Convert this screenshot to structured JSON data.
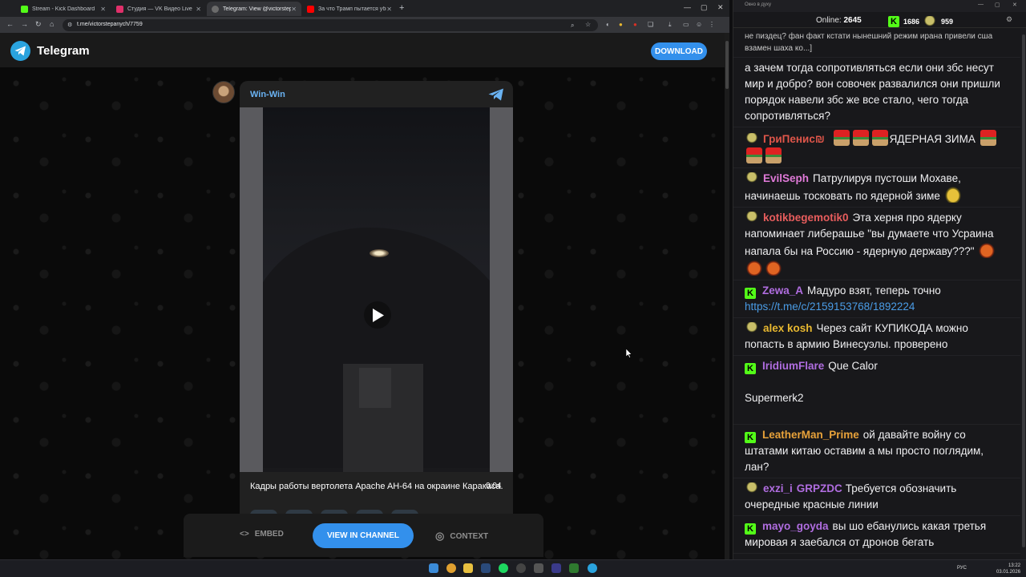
{
  "browser": {
    "tabs": [
      {
        "label": "Stream - Kick Dashboard",
        "active": false,
        "favicon_color": "#53fc18"
      },
      {
        "label": "Студия — VK Видео Live",
        "active": false,
        "favicon_color": "#e0306a"
      },
      {
        "label": "Telegram: View @victorstepanych",
        "active": true,
        "favicon_color": "#6b6b6b"
      },
      {
        "label": "За что Трамп пытается убить Мадуро",
        "active": false,
        "favicon_color": "#ff0000"
      }
    ],
    "new_tab": "+",
    "url": "t.me/victorstepanych/7759"
  },
  "telegram": {
    "brand": "Telegram",
    "download_label": "DOWNLOAD",
    "post": {
      "channel": "Win-Win",
      "duration": "0:04",
      "caption": "Кадры работы вертолета Apache AH-64 на окраине Каракаса."
    },
    "actions": {
      "embed": "EMBED",
      "view_in_channel": "VIEW IN CHANNEL",
      "context": "CONTEXT"
    }
  },
  "chat": {
    "window_title": "Окно в духу",
    "online_label": "Online:",
    "online_count": "2645",
    "kick_count": "1686",
    "other_count": "959",
    "messages": [
      {
        "partial": true,
        "text": "не пиздец? фан факт кстати нынешний режим ирана привели сша взамен шаха ко...]"
      },
      {
        "partial": false,
        "text": "а зачем тогда сопротивляться если они збс несут мир и добро? вон совочек развалился они пришли порядок навели збс же все стало, чего тогда сопротивляться?"
      },
      {
        "badge": "y",
        "user": "ГриПенис₪",
        "user_color": "#e0564a",
        "text": "ЯДЕРНАЯ ЗИМА",
        "emotes_before": 3,
        "emotes_after": 2,
        "emote": "gnome"
      },
      {
        "badge": "y",
        "user": "EvilSeph",
        "user_color": "#e07ad8",
        "text": "Патрулируя пустоши Мохаве, начинаешь тосковать по ядерной зиме",
        "emotes_after": 1,
        "emote": "fish"
      },
      {
        "badge": "y",
        "user": "kotikbegemotik0",
        "user_color": "#e85d5d",
        "text": "Эта херня про ядерку напоминает либерашье \"вы думаете что Усраина напала бы на Россию - ядерную державу???\"",
        "emotes_after": 3,
        "emote": "fox"
      },
      {
        "badge": "k",
        "user": "Zewa_A",
        "user_color": "#b06de0",
        "text": "Мадуро взят, теперь точно",
        "link": "https://t.me/c/2159153768/1892224"
      },
      {
        "badge": "y",
        "user": "alex kosh",
        "user_color": "#e8b830",
        "text": "Через сайт КУПИКОДА можно попасть в армию Винесуэлы. проверено"
      },
      {
        "badge": "k",
        "user": "IridiumFlare",
        "user_color": "#b06de0",
        "text": "Que Calor"
      },
      {
        "plain": true,
        "text": "Supermerk2"
      },
      {
        "badge": "k",
        "user": "LeatherMan_Prime",
        "user_color": "#e8a23a",
        "text": "ой давайте войну со штатами китаю оставим а мы просто поглядим, лан?"
      },
      {
        "badge": "y",
        "user": "exzi_i",
        "user_color": "#b06de0",
        "user2": "GRPZDC",
        "user2_color": "#b06de0",
        "text": "Требуется обозначить очередные красные линии"
      },
      {
        "badge": "k",
        "user": "mayo_goyda",
        "user_color": "#b06de0",
        "text": "вы шо ебанулись какая третья мировая я заебался от дронов бегать"
      }
    ]
  },
  "taskbar": {
    "lang": "РУС",
    "time": "13:22",
    "date": "03.01.2026"
  }
}
